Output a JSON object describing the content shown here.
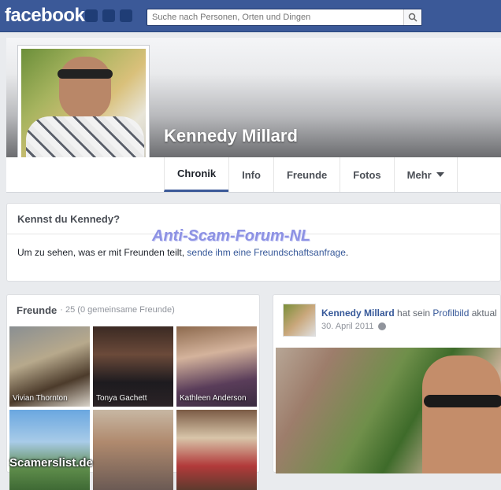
{
  "header": {
    "logo": "facebook",
    "search_placeholder": "Suche nach Personen, Orten und Dingen"
  },
  "profile": {
    "name": "Kennedy Millard",
    "tabs": [
      "Chronik",
      "Info",
      "Freunde",
      "Fotos",
      "Mehr"
    ]
  },
  "know_card": {
    "title": "Kennst du Kennedy?",
    "text_prefix": "Um zu sehen, was er mit Freunden teilt, ",
    "link": "sende ihm eine Freundschaftsanfrage",
    "suffix": "."
  },
  "watermark": "Anti-Scam-Forum-NL",
  "friends": {
    "title": "Freunde",
    "count": "· 25 (0 gemeinsame Freunde)",
    "items": [
      "Vivian Thornton",
      "Tonya Gachett",
      "Kathleen Anderson",
      "",
      "",
      ""
    ]
  },
  "post": {
    "author": "Kennedy Millard",
    "action": " hat sein ",
    "object": "Profilbild",
    "tail": " aktual",
    "date": "30. April 2011"
  },
  "footer_watermark": "Scamerslist.de"
}
